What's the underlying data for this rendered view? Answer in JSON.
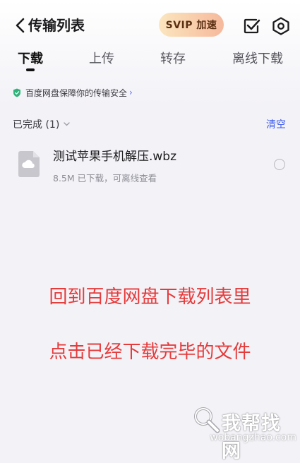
{
  "header": {
    "title": "传输列表",
    "svip_label": "SVIP 加速",
    "icons": [
      "back-icon",
      "checkbox-icon",
      "settings-icon"
    ]
  },
  "tabs": [
    {
      "label": "下载",
      "active": true
    },
    {
      "label": "上传",
      "active": false
    },
    {
      "label": "转存",
      "active": false
    },
    {
      "label": "离线下载",
      "active": false
    }
  ],
  "safety_notice": "百度网盘保障你的传输安全",
  "section": {
    "title": "已完成 (1)",
    "clear_label": "清空"
  },
  "files": [
    {
      "name": "测试苹果手机解压.wbz",
      "meta": "8.5M  已下载，可离线查看"
    }
  ],
  "overlay": {
    "line1": "回到百度网盘下载列表里",
    "line2": "点击已经下载完毕的文件"
  },
  "watermark": {
    "cn": "我帮找网",
    "en": "wobangzhao.com"
  },
  "colors": {
    "accent": "#3e5ef0",
    "overlay_text": "#e63b3b",
    "svip_gradient_start": "#fbe6bf",
    "svip_gradient_end": "#f6b99c"
  }
}
